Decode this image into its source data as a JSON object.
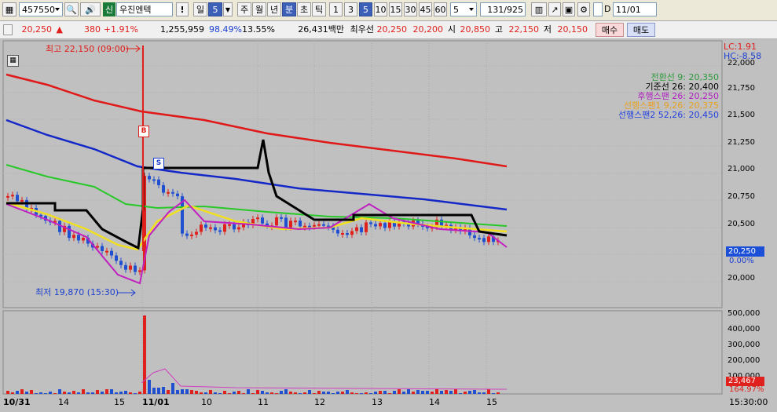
{
  "toolbar": {
    "code": "457550",
    "market_badge": "신",
    "stock_name": "우진엔텍",
    "warn": "!",
    "period_tabs": [
      "일",
      "주",
      "월",
      "년",
      "분",
      "초",
      "틱"
    ],
    "period_selected": "분",
    "day_count": "5",
    "intervals": [
      "1",
      "3",
      "5",
      "10",
      "15",
      "30",
      "45",
      "60"
    ],
    "interval_selected": "5",
    "count_box": "5",
    "range_text": "131",
    "range_total": "/925",
    "date": "11/01",
    "d_label": "D"
  },
  "quote": {
    "price": "20,250",
    "change_arrow": "▲",
    "change": "380",
    "change_pct": "+1.91%",
    "volume": "1,255,959",
    "vol_ratio": "98.49%",
    "turnover_ratio": "13.55%",
    "amount": "26,431백만",
    "ask_label": "최우선",
    "ask": "20,250",
    "bid": "20,200",
    "open_label": "시",
    "open": "20,850",
    "high_label": "고",
    "high": "22,150",
    "low_label": "저",
    "low": "20,150",
    "buy_button": "매수",
    "sell_button": "매도"
  },
  "chart": {
    "lc_label": "LC:1.91",
    "hc_label": "HC:-8.58",
    "high_annotation": "최고 22,150 (09:00)",
    "low_annotation": "최저 19,870 (15:30)",
    "buy_marker": "B",
    "sell_marker": "S",
    "legend": [
      {
        "text": "전환선 9: 20,350",
        "color": "#2e9a3c"
      },
      {
        "text": "기준선 26: 20,400",
        "color": "#000000"
      },
      {
        "text": "후행스팬 26: 20,250",
        "color": "#b020c0"
      },
      {
        "text": "선행스팬1 9,26: 20,375",
        "color": "#e8a020"
      },
      {
        "text": "선행스팬2 52,26: 20,450",
        "color": "#2040e0"
      }
    ],
    "price_ticks": [
      "22,000",
      "21,750",
      "21,500",
      "21,250",
      "21,000",
      "20,750",
      "20,500",
      "20,250",
      "20,000"
    ],
    "price_tag": "20,250",
    "pct_tag": "0.00%",
    "volume_ticks": [
      "500,000",
      "400,000",
      "300,000",
      "200,000",
      "100,000"
    ],
    "volume_tag": "23,467",
    "volume_pct": "164.97%",
    "x_labels": [
      "10/31",
      "14",
      "15",
      "11/01",
      "10",
      "11",
      "12",
      "13",
      "14",
      "15"
    ],
    "time_label": "15:30:00",
    "colors": {
      "up": "#e0201c",
      "down": "#2050d0",
      "ma_long": "#e01818",
      "ma_mid": "#1428c8",
      "ma_short": "#28c828",
      "yellow": "#f0e020",
      "magenta": "#c020c0",
      "base": "#000000"
    }
  }
}
